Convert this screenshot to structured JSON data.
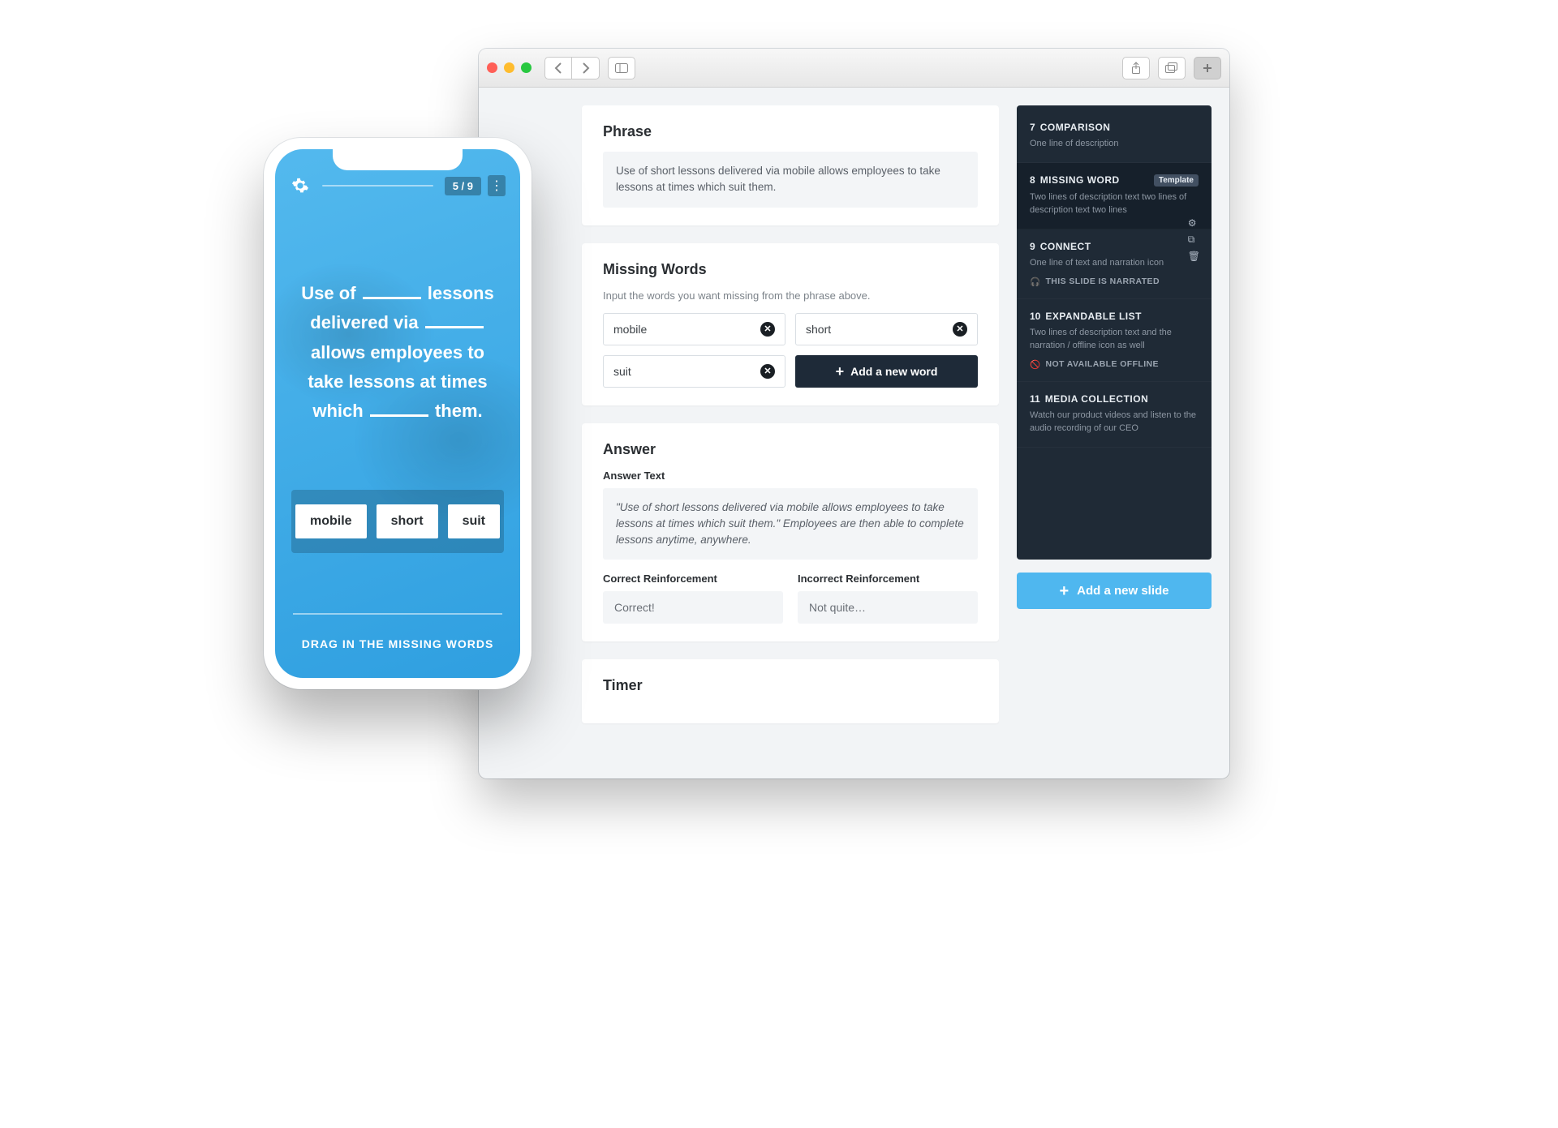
{
  "browser": {
    "titlebar": {}
  },
  "editor": {
    "phrase": {
      "heading": "Phrase",
      "text": "Use of short lessons delivered via mobile allows employees to take lessons at times which suit them."
    },
    "missing": {
      "heading": "Missing Words",
      "help": "Input the words you want missing from the phrase above.",
      "words": [
        "mobile",
        "short",
        "suit"
      ],
      "add_label": "Add a new word"
    },
    "answer": {
      "heading": "Answer",
      "text_label": "Answer Text",
      "text": "\"Use of short lessons delivered via mobile allows employees to take lessons at times which suit them.\" Employees are then able to complete lessons anytime, anywhere.",
      "correct_label": "Correct Reinforcement",
      "correct_value": "Correct!",
      "incorrect_label": "Incorrect Reinforcement",
      "incorrect_value": "Not quite…"
    },
    "timer": {
      "heading": "Timer"
    }
  },
  "sidebar": {
    "slides": [
      {
        "num": "7",
        "title": "COMPARISON",
        "desc": "One line of description"
      },
      {
        "num": "8",
        "title": "MISSING WORD",
        "desc": "Two lines of description text two lines of description text two lines",
        "badge": "Template",
        "active": true
      },
      {
        "num": "9",
        "title": "CONNECT",
        "desc": "One line of text and narration icon",
        "meta": "THIS SLIDE IS NARRATED",
        "meta_icon": "headphones"
      },
      {
        "num": "10",
        "title": "EXPANDABLE LIST",
        "desc": "Two lines of description text and the narration / offline icon as well",
        "meta": "NOT AVAILABLE OFFLINE",
        "meta_icon": "offline"
      },
      {
        "num": "11",
        "title": "MEDIA COLLECTION",
        "desc": "Watch our product videos and listen to the audio recording of our CEO"
      }
    ],
    "add_label": "Add a new slide"
  },
  "phone": {
    "page_indicator": "5 / 9",
    "phrase_parts": [
      "Use of ",
      " lessons delivered via ",
      " allows employees to take lessons at times which ",
      " them."
    ],
    "chips": [
      "mobile",
      "short",
      "suit"
    ],
    "instruction": "DRAG IN THE MISSING WORDS"
  }
}
